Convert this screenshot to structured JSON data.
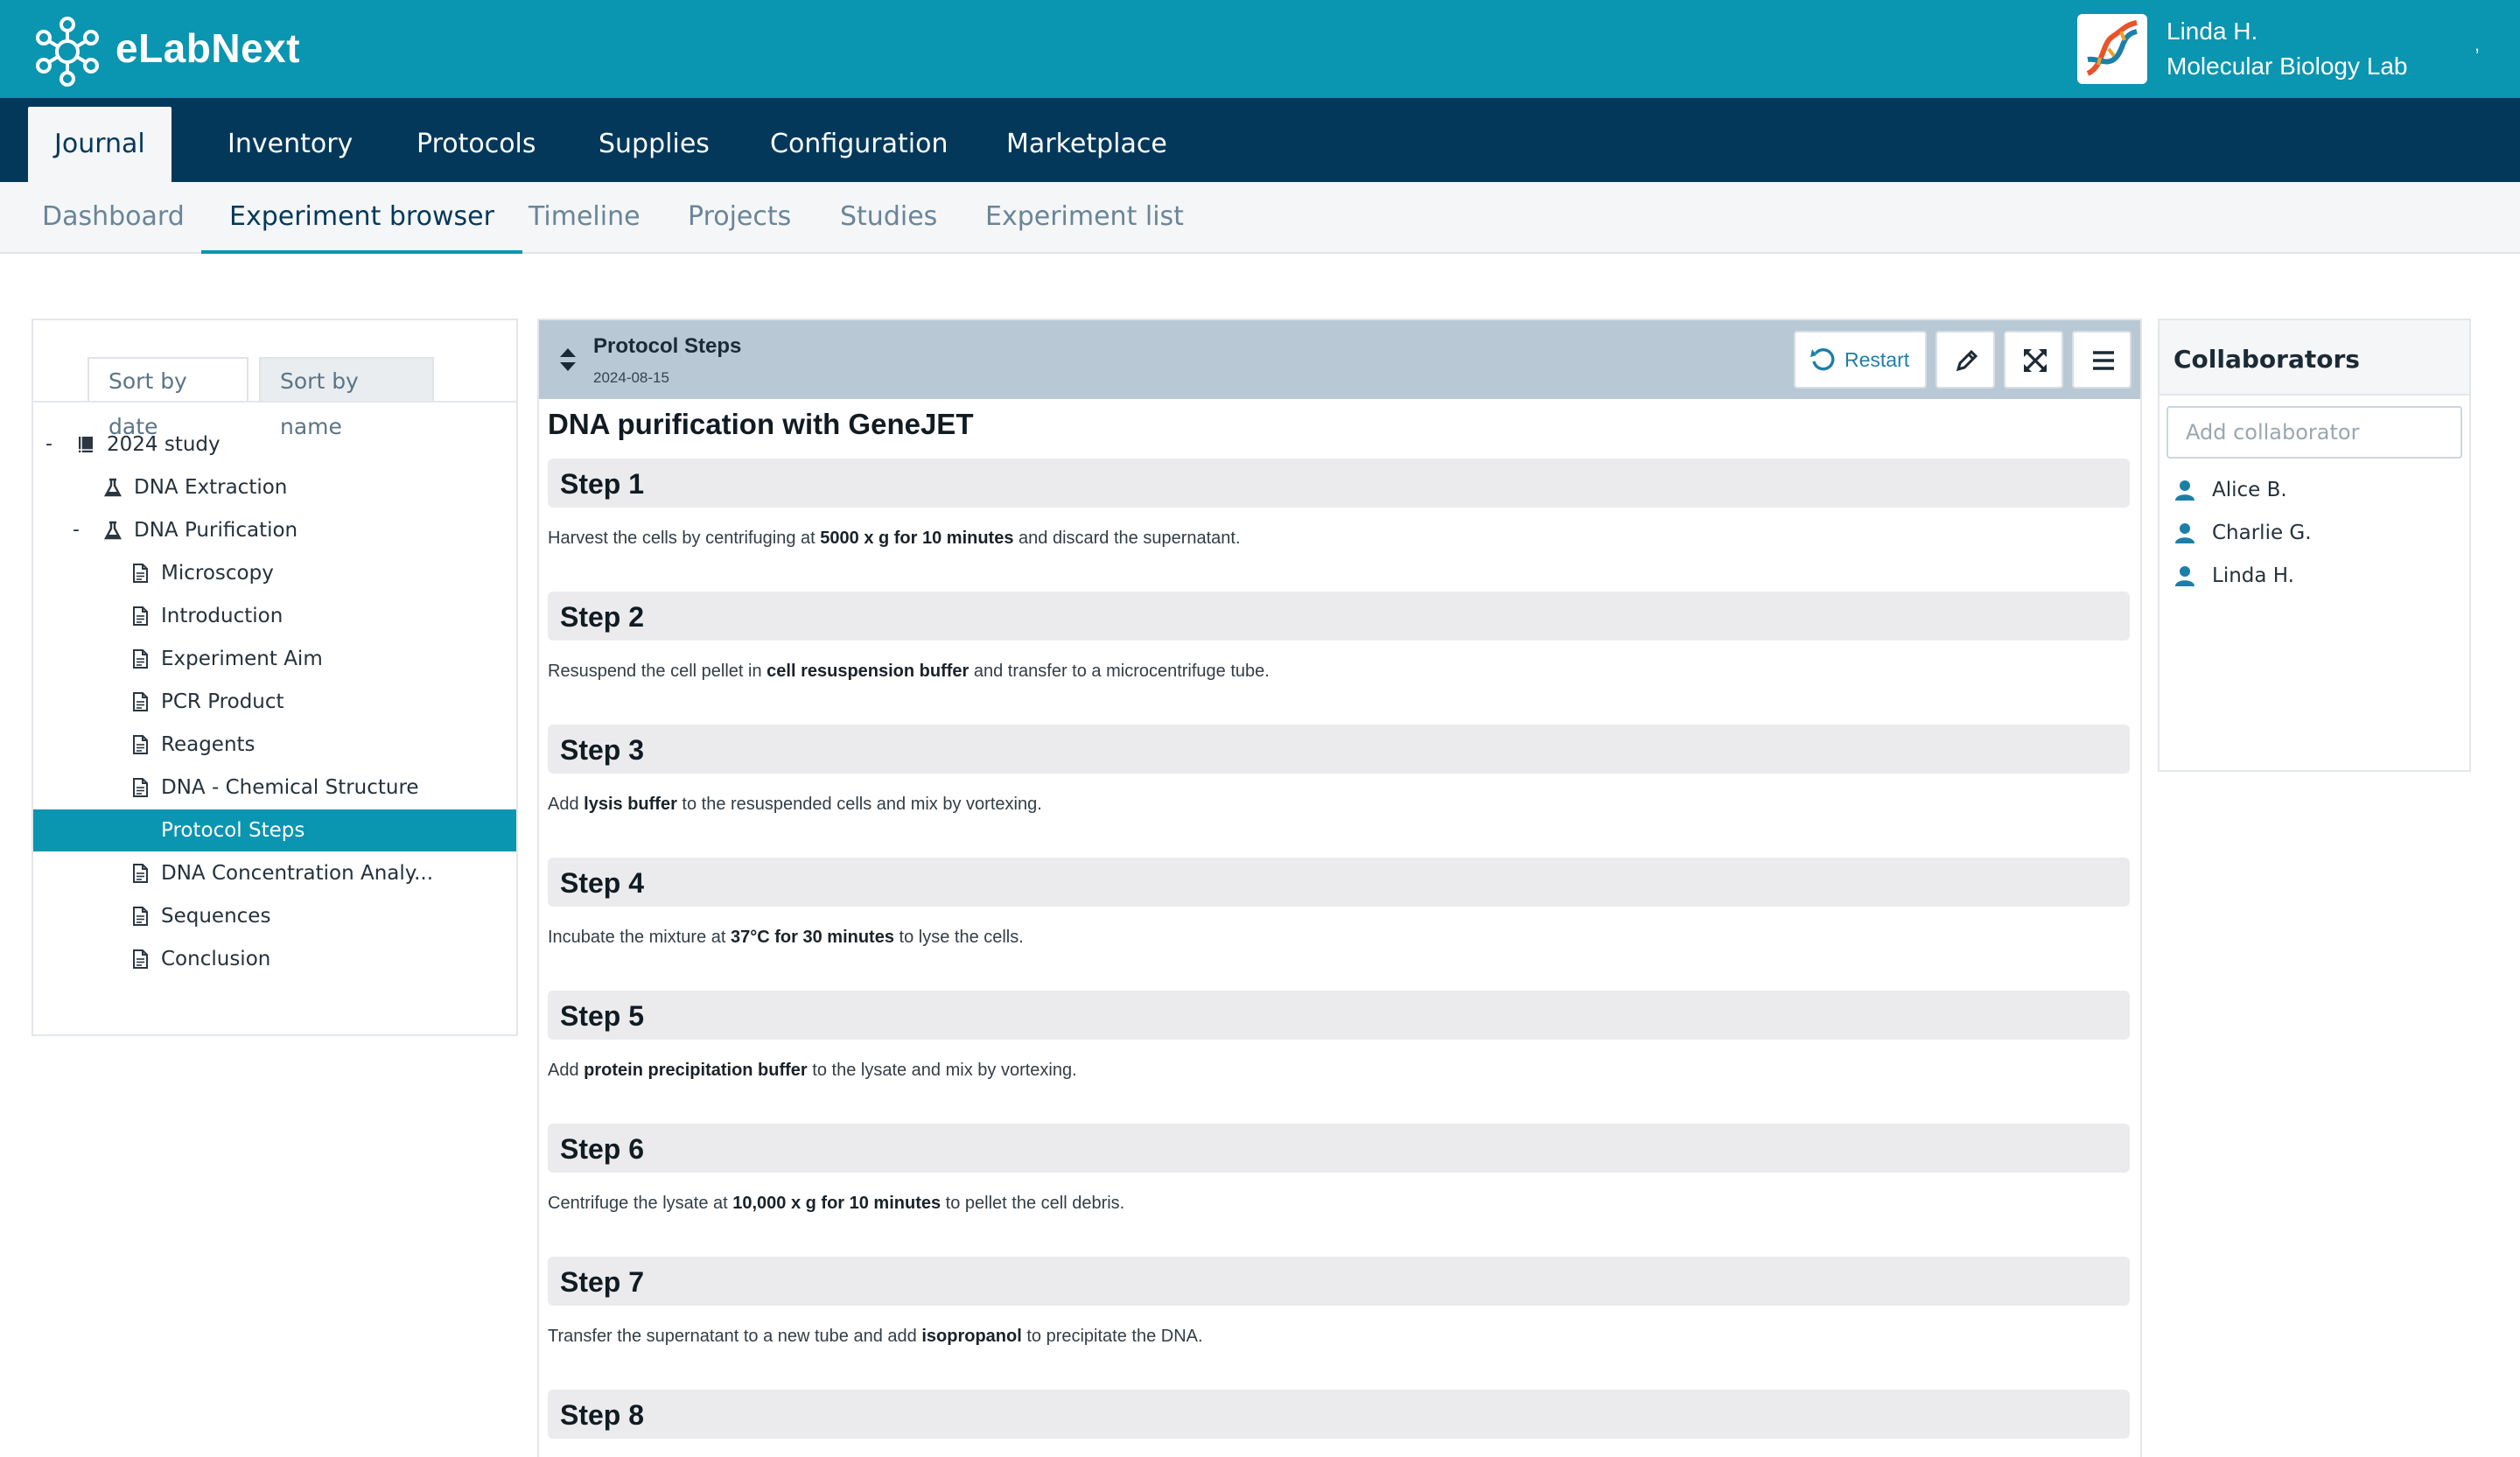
{
  "brand": {
    "name": "eLabNext"
  },
  "user": {
    "name": "Linda H.",
    "lab": "Molecular Biology Lab",
    "caret": ","
  },
  "main_nav": {
    "tabs": [
      "Journal",
      "Inventory",
      "Protocols",
      "Supplies",
      "Configuration",
      "Marketplace"
    ]
  },
  "sub_nav": {
    "tabs": [
      "Dashboard",
      "Experiment browser",
      "Timeline",
      "Projects",
      "Studies",
      "Experiment list"
    ]
  },
  "tree_panel": {
    "sort_tabs": [
      "Sort by date",
      "Sort by name"
    ],
    "nodes": [
      {
        "label": "2024 study",
        "toggle": "-",
        "icon": "book-icon"
      },
      {
        "label": "DNA Extraction",
        "toggle": "",
        "icon": "flask-icon"
      },
      {
        "label": "DNA Purification",
        "toggle": "-",
        "icon": "flask-icon"
      },
      {
        "label": "Microscopy",
        "toggle": "",
        "icon": "document-icon"
      },
      {
        "label": "Introduction",
        "toggle": "",
        "icon": "document-icon"
      },
      {
        "label": "Experiment Aim",
        "toggle": "",
        "icon": "document-icon"
      },
      {
        "label": "PCR Product",
        "toggle": "",
        "icon": "document-icon"
      },
      {
        "label": "Reagents",
        "toggle": "",
        "icon": "document-icon"
      },
      {
        "label": "DNA - Chemical Structure",
        "toggle": "",
        "icon": "document-icon"
      },
      {
        "label": "Protocol Steps",
        "toggle": "",
        "icon": "document-icon"
      },
      {
        "label": "DNA Concentration Analy...",
        "toggle": "",
        "icon": "document-icon"
      },
      {
        "label": "Sequences",
        "toggle": "",
        "icon": "document-icon"
      },
      {
        "label": "Conclusion",
        "toggle": "",
        "icon": "document-icon"
      }
    ]
  },
  "section": {
    "title": "Protocol Steps",
    "date": "2024-08-15",
    "restart_label": "Restart",
    "doc_title": "DNA purification with GeneJET",
    "steps": [
      {
        "title": "Step 1",
        "text": [
          [
            "Harvest the cells by centrifuging at ",
            false
          ],
          [
            "5000 x g for 10 minutes",
            true
          ],
          [
            " and discard the supernatant.",
            false
          ]
        ]
      },
      {
        "title": "Step 2",
        "text": [
          [
            "Resuspend the cell pellet in ",
            false
          ],
          [
            "cell resuspension buffer",
            true
          ],
          [
            " and transfer to a microcentrifuge tube.",
            false
          ]
        ]
      },
      {
        "title": "Step 3",
        "text": [
          [
            "Add ",
            false
          ],
          [
            "lysis buffer",
            true
          ],
          [
            " to the resuspended cells and mix by vortexing.",
            false
          ]
        ]
      },
      {
        "title": "Step 4",
        "text": [
          [
            "Incubate the mixture at ",
            false
          ],
          [
            "37°C for 30 minutes",
            true
          ],
          [
            " to lyse the cells.",
            false
          ]
        ]
      },
      {
        "title": "Step 5",
        "text": [
          [
            "Add ",
            false
          ],
          [
            "protein precipitation buffer",
            true
          ],
          [
            " to the lysate and mix by vortexing.",
            false
          ]
        ]
      },
      {
        "title": "Step 6",
        "text": [
          [
            "Centrifuge the lysate at ",
            false
          ],
          [
            "10,000 x g for 10 minutes",
            true
          ],
          [
            " to pellet the cell debris.",
            false
          ]
        ]
      },
      {
        "title": "Step 7",
        "text": [
          [
            "Transfer the supernatant to a new tube and add ",
            false
          ],
          [
            "isopropanol",
            true
          ],
          [
            " to precipitate the DNA.",
            false
          ]
        ]
      },
      {
        "title": "Step 8",
        "text": []
      }
    ]
  },
  "collaborators": {
    "title": "Collaborators",
    "input_placeholder": "Add collaborator",
    "people": [
      "Alice B.",
      "Charlie G.",
      "Linda H."
    ]
  },
  "colors": {
    "brand": "#0a95b0",
    "nav": "#03385a",
    "selected": "#0a95b0",
    "section_header": "#b8c9d5"
  }
}
